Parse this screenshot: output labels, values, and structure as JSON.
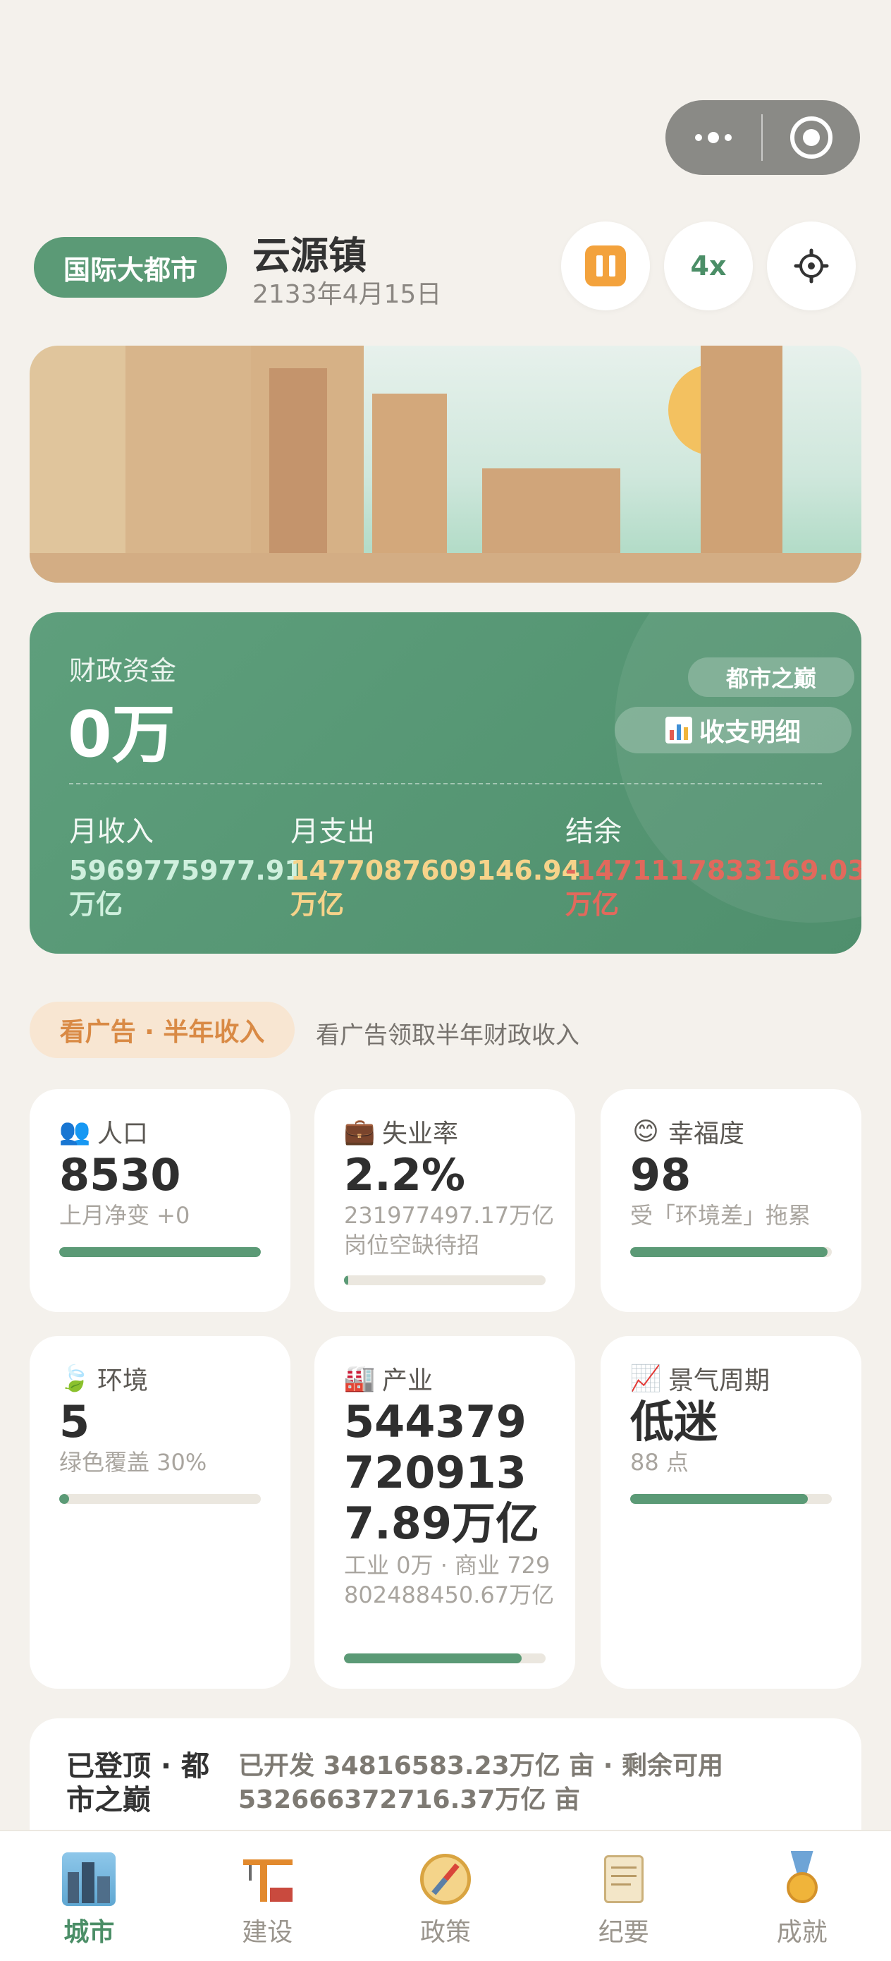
{
  "capsule": {
    "more_icon": "more-dots-icon",
    "close_icon": "target-circle-icon"
  },
  "header": {
    "level_badge": "国际大都市",
    "city_name": "云源镇",
    "date": "2133年4月15日",
    "speed_label": "4x",
    "pause_icon": "pause-icon",
    "settings_icon": "gear-icon"
  },
  "finance": {
    "label": "财政资金",
    "value": "0万",
    "tag": "都市之巅",
    "detail_button": "收支明细",
    "income_label": "月收入",
    "income_value": "5969775977.91",
    "income_unit": "万亿",
    "expense_label": "月支出",
    "expense_value": "1477087609146.94",
    "expense_unit": "万亿",
    "balance_label": "结余",
    "balance_value": "-1471117833169.03",
    "balance_unit": "万亿",
    "colors": {
      "income": "#cff0de",
      "expense": "#f6d38a",
      "balance": "#e2695c"
    }
  },
  "ad": {
    "button": "看广告 · 半年收入",
    "description": "看广告领取半年财政收入"
  },
  "stats": {
    "population": {
      "icon": "people-icon",
      "title": "人口",
      "value": "8530",
      "sub": "上月净变 +0",
      "progress": 1.0
    },
    "unemployment": {
      "icon": "briefcase-icon",
      "title": "失业率",
      "value": "2.2%",
      "sub": "231977497.17万亿岗位空缺待招",
      "progress": 0.022
    },
    "happiness": {
      "icon": "smile-icon",
      "title": "幸福度",
      "value": "98",
      "sub": "受「环境差」拖累",
      "progress": 0.98
    },
    "environment": {
      "icon": "leaf-icon",
      "title": "环境",
      "value": "5",
      "sub": "绿色覆盖 30%",
      "progress": 0.05
    },
    "industry": {
      "icon": "factory-icon",
      "title": "产业",
      "value": "5443797209137.89万亿",
      "sub": "工业 0万 · 商业 729802488450.67万亿",
      "progress": 0.88
    },
    "cycle": {
      "icon": "trend-chart-icon",
      "title": "景气周期",
      "value": "低迷",
      "sub": "88 点",
      "progress": 0.88
    }
  },
  "summit": {
    "title": "已登顶 · 都市之巅",
    "detail": "已开发 34816583.23万亿 亩 · 剩余可用 532666372716.37万亿 亩"
  },
  "tabs": [
    {
      "label": "城市",
      "icon": "city-icon",
      "active": true
    },
    {
      "label": "建设",
      "icon": "crane-icon",
      "active": false
    },
    {
      "label": "政策",
      "icon": "compass-icon",
      "active": false
    },
    {
      "label": "纪要",
      "icon": "scroll-icon",
      "active": false
    },
    {
      "label": "成就",
      "icon": "medal-icon",
      "active": false
    }
  ]
}
